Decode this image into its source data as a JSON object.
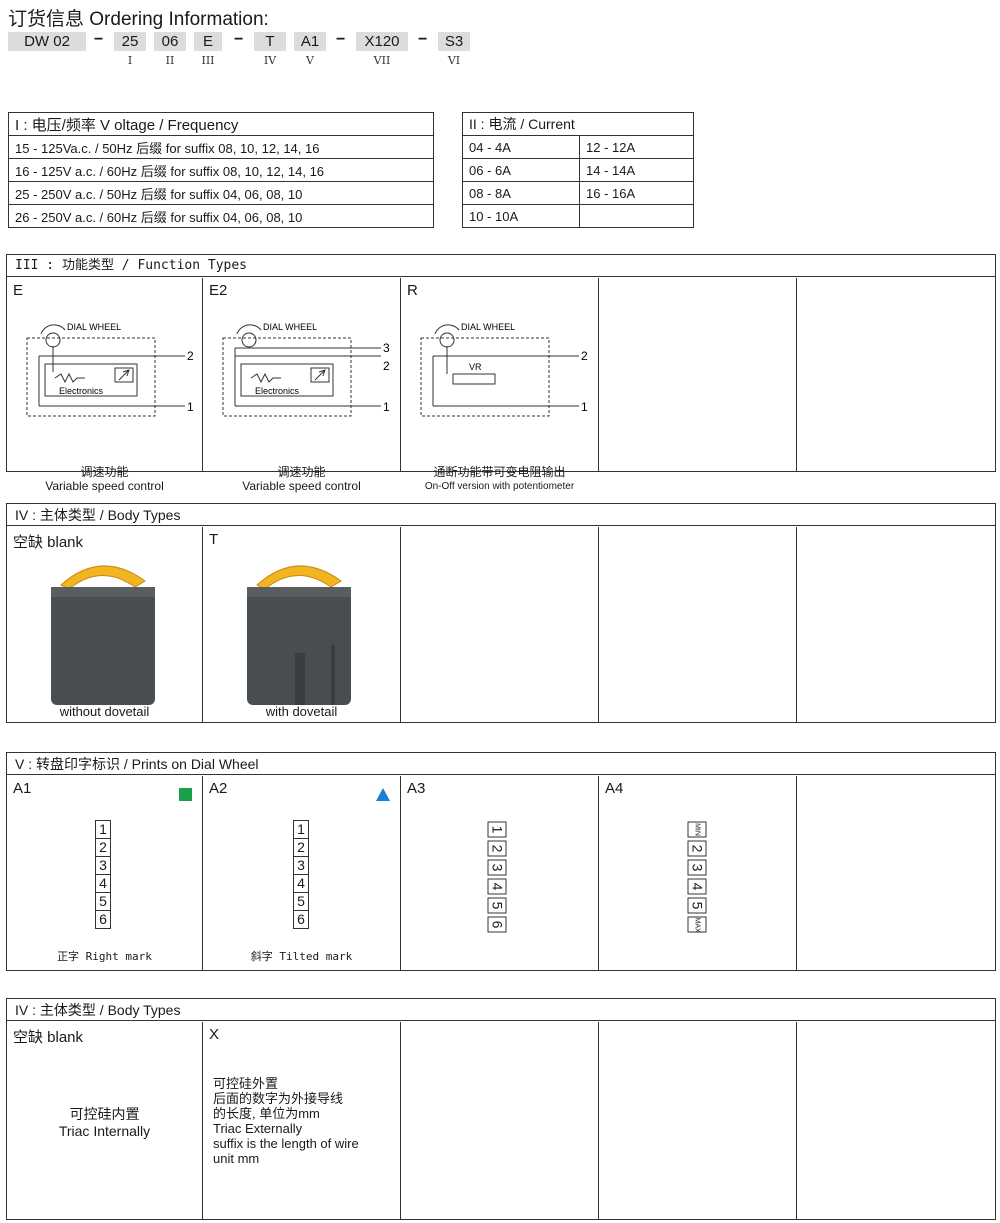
{
  "title": "订货信息  Ordering Information:",
  "code": {
    "segments": [
      "DW 02",
      "25",
      "06",
      "E",
      "T",
      "A1",
      "X120",
      "S3"
    ],
    "dash": "−",
    "romans": [
      "I",
      "II",
      "III",
      "IV",
      "V",
      "VII",
      "VI"
    ]
  },
  "voltage": {
    "header": "I : 电压/频率  V oltage / Frequency",
    "rows": [
      "15 - 125Va.c. / 50Hz   后缀  for suffix 08, 10, 12, 14, 16",
      "16 - 125V a.c. / 60Hz   后缀  for suffix 08, 10, 12, 14, 16",
      "25 - 250V a.c. / 50Hz   后缀  for suffix 04, 06, 08, 10",
      "26 - 250V a.c. / 60Hz   后缀  for suffix 04, 06, 08, 10"
    ]
  },
  "current": {
    "header": "II : 电流 / Current",
    "rows": [
      [
        "04 - 4A",
        "12 - 12A"
      ],
      [
        "06 - 6A",
        "14 - 14A"
      ],
      [
        "08 - 8A",
        "16 - 16A"
      ],
      [
        "10 - 10A",
        ""
      ]
    ]
  },
  "functions": {
    "header": "III : 功能类型  /  Function  Types",
    "items": [
      {
        "code": "E",
        "cn": "调速功能",
        "en": "Variable speed control"
      },
      {
        "code": "E2",
        "cn": "调速功能",
        "en": "Variable speed control"
      },
      {
        "code": "R",
        "cn": "通断功能带可变电阻输出",
        "en": "On-Off version with potentiometer"
      }
    ],
    "diagram": {
      "dial": "DIAL WHEEL",
      "elec": "Electronics",
      "vr": "VR",
      "t1": "1",
      "t2": "2",
      "t3": "3"
    }
  },
  "body1": {
    "header": "IV : 主体类型 / Body Types",
    "items": [
      {
        "code": "空缺  blank",
        "caption": "without dovetail"
      },
      {
        "code": "T",
        "caption": "with dovetail"
      }
    ]
  },
  "prints": {
    "header": "V : 转盘印字标识 / Prints on Dial Wheel",
    "items": [
      {
        "code": "A1",
        "caption": "正字 Right mark"
      },
      {
        "code": "A2",
        "caption": "斜字 Tilted mark"
      },
      {
        "code": "A3",
        "caption": ""
      },
      {
        "code": "A4",
        "caption": ""
      }
    ],
    "numbers": [
      "1",
      "2",
      "3",
      "4",
      "5",
      "6"
    ],
    "a4": [
      "MIN",
      "2",
      "3",
      "4",
      "5",
      "MAX"
    ],
    "colors": {
      "green": "#1aa04a",
      "blue": "#1e7fd0"
    }
  },
  "body2": {
    "header": "IV : 主体类型 / Body Types",
    "items": [
      {
        "code": "空缺  blank",
        "line1": "可控硅内置",
        "line2": "Triac Internally"
      },
      {
        "code": "X",
        "lines": [
          "可控硅外置",
          "后面的数字为外接导线",
          "的长度, 单位为mm",
          "Triac Externally",
          "suffix is the length of wire",
          "unit mm"
        ]
      }
    ]
  }
}
